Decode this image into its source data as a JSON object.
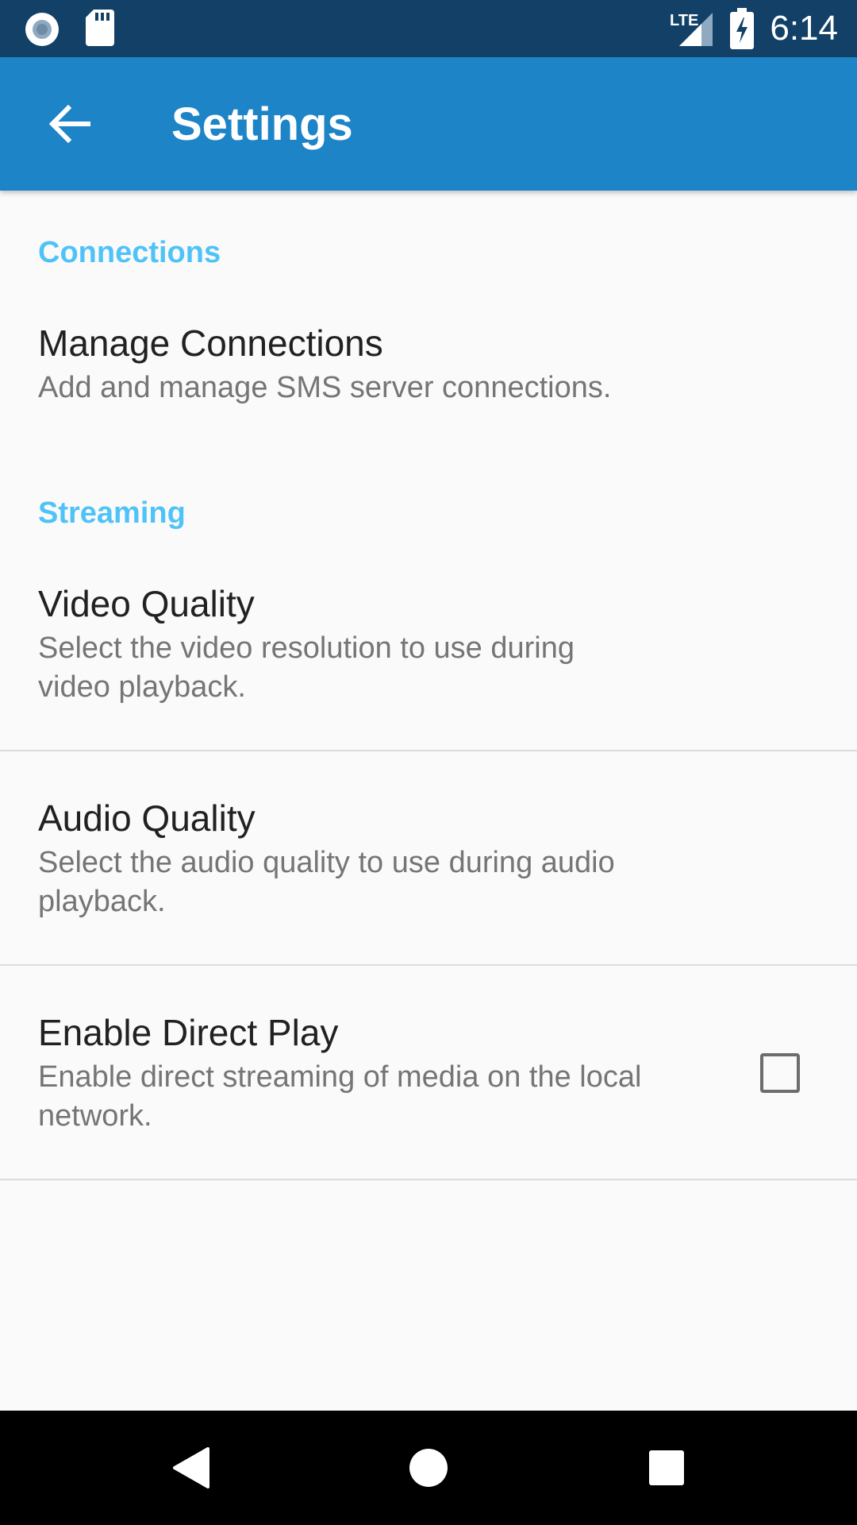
{
  "status_bar": {
    "time": "6:14",
    "network": "LTE",
    "icons": [
      "record-icon",
      "sd-card-icon",
      "lte-signal-icon",
      "battery-charging-icon"
    ]
  },
  "app_bar": {
    "title": "Settings",
    "back_icon": "arrow-back-icon"
  },
  "sections": [
    {
      "header": "Connections",
      "items": [
        {
          "title": "Manage Connections",
          "summary": "Add and manage SMS server connections."
        }
      ]
    },
    {
      "header": "Streaming",
      "items": [
        {
          "title": "Video Quality",
          "summary": "Select the video resolution to use during video playback."
        },
        {
          "title": "Audio Quality",
          "summary": "Select the audio quality to use during audio playback."
        },
        {
          "title": "Enable Direct Play",
          "summary": "Enable direct streaming of media on the local network.",
          "checked": false
        }
      ]
    }
  ],
  "nav_bar": {
    "icons": [
      "back-triangle-icon",
      "home-circle-icon",
      "recents-square-icon"
    ]
  },
  "colors": {
    "status_bar": "#124066",
    "app_bar": "#1c84c7",
    "accent": "#4fc3f7",
    "background": "#fafafa"
  }
}
